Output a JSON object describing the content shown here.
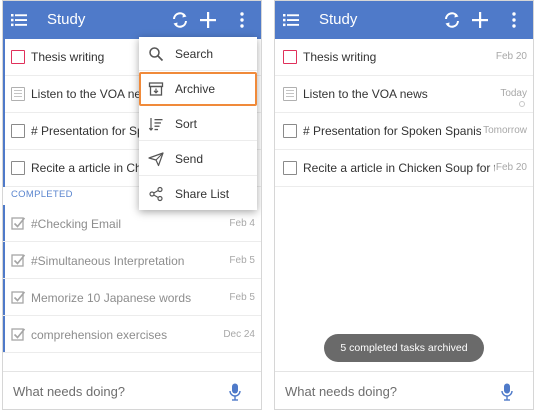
{
  "left_screen": {
    "appbar": {
      "title": "Study"
    },
    "tasks": [
      {
        "text": "Thesis writing",
        "date": "",
        "style": "red"
      },
      {
        "text": "Listen to the VOA news",
        "date": "",
        "style": "note"
      },
      {
        "text": "# Presentation for Sp",
        "date": "",
        "style": "plain"
      },
      {
        "text": "Recite a article in Chi",
        "date": "",
        "style": "plain"
      }
    ],
    "completed_header": "COMPLETED",
    "completed": [
      {
        "text": "#Checking Email",
        "date": "Feb 4"
      },
      {
        "text": "#Simultaneous Interpretation",
        "date": "Feb 5"
      },
      {
        "text": "Memorize 10 Japanese words",
        "date": "Feb 5"
      },
      {
        "text": "comprehension exercises",
        "date": "Dec 24"
      }
    ],
    "menu": [
      {
        "label": "Search",
        "icon": "search-icon"
      },
      {
        "label": "Archive",
        "icon": "archive-icon"
      },
      {
        "label": "Sort",
        "icon": "sort-icon"
      },
      {
        "label": "Send",
        "icon": "send-icon"
      },
      {
        "label": "Share List",
        "icon": "share-icon"
      }
    ],
    "input_placeholder": "What needs doing?"
  },
  "right_screen": {
    "appbar": {
      "title": "Study"
    },
    "tasks": [
      {
        "text": "Thesis writing",
        "date": "Feb 20",
        "style": "red"
      },
      {
        "text": "Listen to the VOA news",
        "date": "Today",
        "style": "note"
      },
      {
        "text": "# Presentation for Spoken Spanis…",
        "date": "Tomorrow",
        "style": "plain"
      },
      {
        "text": "Recite a article in Chicken Soup for t…",
        "date": "Feb 20",
        "style": "plain"
      }
    ],
    "toast": "5 completed tasks archived",
    "input_placeholder": "What needs doing?"
  },
  "colors": {
    "appbar": "#4f7ac9",
    "accent_red": "#e0305a",
    "highlight_border": "#f08a3a",
    "completed_label": "#5b86cf"
  }
}
